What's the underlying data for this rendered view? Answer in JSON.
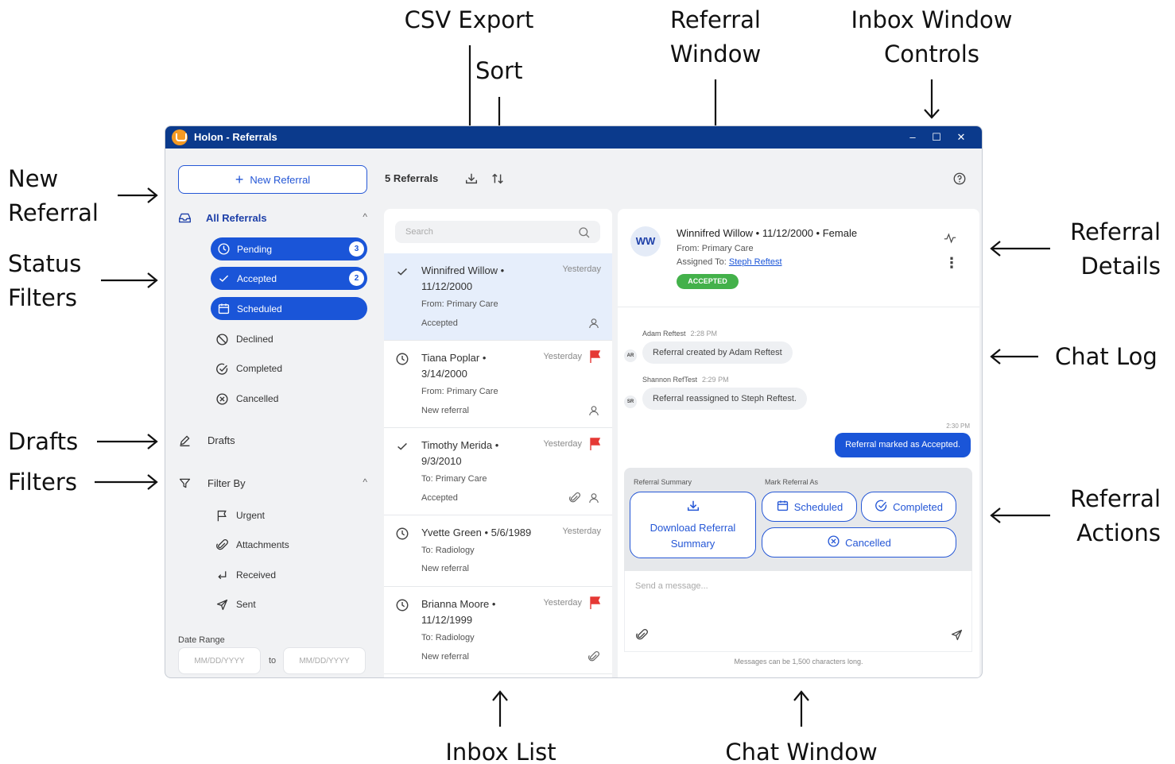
{
  "annotations": {
    "csv_export": "CSV Export",
    "sort": "Sort",
    "referral_window_1": "Referral",
    "referral_window_2": "Window",
    "inbox_window_controls_1": "Inbox Window",
    "inbox_window_controls_2": "Controls",
    "new_referral_1": "New",
    "new_referral_2": "Referral",
    "status_filters_1": "Status",
    "status_filters_2": "Filters",
    "drafts": "Drafts",
    "filters": "Filters",
    "referral_details_1": "Referral",
    "referral_details_2": "Details",
    "chat_log": "Chat Log",
    "referral_actions_1": "Referral",
    "referral_actions_2": "Actions",
    "inbox_list": "Inbox List",
    "chat_window": "Chat Window"
  },
  "window": {
    "title": "Holon - Referrals",
    "controls": {
      "minimize": "–",
      "maximize": "☐",
      "close": "✕"
    }
  },
  "sidebar": {
    "new_referral": "New Referral",
    "all_referrals": "All Referrals",
    "status_filters": [
      {
        "label": "Pending",
        "icon": "clock-icon",
        "badge": "3",
        "active": true
      },
      {
        "label": "Accepted",
        "icon": "check-icon",
        "badge": "2",
        "active": true
      },
      {
        "label": "Scheduled",
        "icon": "calendar-icon",
        "badge": "",
        "active": true
      },
      {
        "label": "Declined",
        "icon": "ban-icon",
        "active": false
      },
      {
        "label": "Completed",
        "icon": "check-circle-icon",
        "active": false
      },
      {
        "label": "Cancelled",
        "icon": "x-circle-icon",
        "active": false
      }
    ],
    "drafts": "Drafts",
    "filter_by": "Filter By",
    "filters": [
      {
        "label": "Urgent",
        "icon": "flag-icon"
      },
      {
        "label": "Attachments",
        "icon": "paperclip-icon"
      },
      {
        "label": "Received",
        "icon": "received-icon"
      },
      {
        "label": "Sent",
        "icon": "send-icon"
      }
    ],
    "date_range": "Date Range",
    "date_from_placeholder": "MM/DD/YYYY",
    "date_to_label": "to",
    "date_to_placeholder": "MM/DD/YYYY"
  },
  "list": {
    "count": "5 Referrals",
    "search_placeholder": "Search",
    "items": [
      {
        "name": "Winnifred Willow • 11/12/2000",
        "when": "Yesterday",
        "from": "From: Primary Care",
        "state": "Accepted",
        "status_icon": "check-icon",
        "urgent": false,
        "attachment": false
      },
      {
        "name": "Tiana Poplar • 3/14/2000",
        "when": "Yesterday",
        "from": "From: Primary Care",
        "state": "New referral",
        "status_icon": "clock-icon",
        "urgent": true,
        "attachment": false
      },
      {
        "name": "Timothy Merida • 9/3/2010",
        "when": "Yesterday",
        "from": "To: Primary Care",
        "state": "Accepted",
        "status_icon": "check-icon",
        "urgent": true,
        "attachment": true
      },
      {
        "name": "Yvette Green • 5/6/1989",
        "when": "Yesterday",
        "from": "To: Radiology",
        "state": "New referral",
        "status_icon": "clock-icon",
        "urgent": false,
        "attachment": false
      },
      {
        "name": "Brianna Moore • 11/12/1999",
        "when": "Yesterday",
        "from": "To: Radiology",
        "state": "New referral",
        "status_icon": "clock-icon",
        "urgent": true,
        "attachment": true
      }
    ]
  },
  "referral": {
    "avatar": "WW",
    "title": "Winnifred Willow • 11/12/2000 • Female",
    "from": "From: Primary Care",
    "assigned_label": "Assigned To:",
    "assigned_to": "Steph Reftest",
    "status": "ACCEPTED",
    "status_color": "#43b14a",
    "chat": [
      {
        "author": "Adam Reftest",
        "time": "2:28 PM",
        "initials": "AR",
        "text": "Referral created by  Adam Reftest"
      },
      {
        "author": "Shannon RefTest",
        "time": "2:29 PM",
        "initials": "SR",
        "text": "Referral reassigned to Steph Reftest."
      }
    ],
    "my_message": {
      "time": "2:30 PM",
      "text": "Referral marked as Accepted."
    },
    "actions": {
      "summary_label": "Referral Summary",
      "mark_label": "Mark Referral As",
      "download_1": "Download Referral",
      "download_2": "Summary",
      "scheduled": "Scheduled",
      "completed": "Completed",
      "cancelled": "Cancelled"
    },
    "compose_placeholder": "Send a message...",
    "limit_note": "Messages can be 1,500 characters long."
  },
  "colors": {
    "titlebar": "#0b3a8c",
    "accent": "#1a55d8",
    "urgent_flag": "#e53935"
  }
}
